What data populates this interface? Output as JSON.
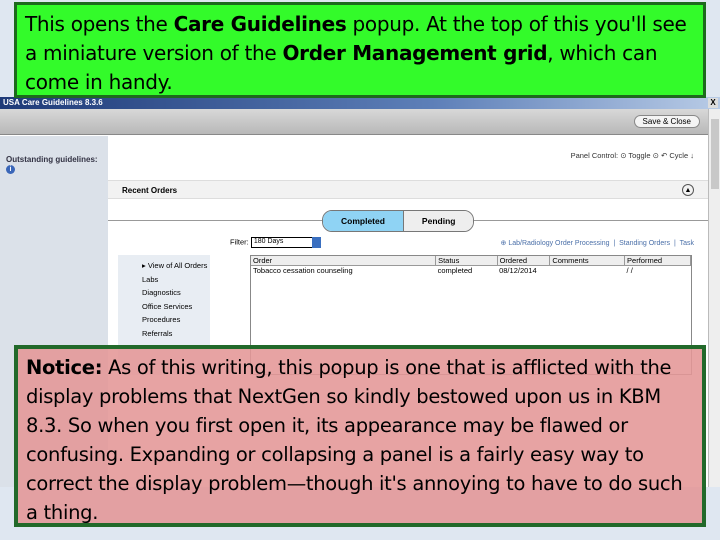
{
  "top_callout": {
    "p1": "This opens the ",
    "b1": "Care Guidelines",
    "p2": " popup.  At the top of this you'll see a miniature version of the ",
    "b2": "Order Management grid",
    "p3": ", which can come in handy."
  },
  "notice": {
    "label": "Notice:",
    "text": " As of this writing, this popup is one that is afflicted with the display problems that NextGen so kindly bestowed upon us in KBM 8.3.  So when you first open it, its appearance may be flawed or confusing.  Expanding or collapsing a panel is a fairly easy way to correct the display problem—though it's annoying to have to do such a thing."
  },
  "window": {
    "title": "USA Care Guidelines 8.3.6",
    "close": "X",
    "save_close": "Save & Close"
  },
  "left": {
    "outstanding": "Outstanding guidelines:"
  },
  "panel_control": {
    "label": "Panel Control:",
    "toggle": "Toggle",
    "cycle": "Cycle"
  },
  "recent_orders": {
    "title": "Recent Orders",
    "tabs": [
      "Completed",
      "Pending"
    ],
    "active_tab": "Completed",
    "filter_label": "Filter:",
    "filter_value": "180 Days",
    "links": [
      "Lab/Radiology Order Processing",
      "Standing Orders",
      "Task"
    ],
    "nav": [
      "View of All Orders",
      "Labs",
      "Diagnostics",
      "Office Services",
      "Procedures",
      "Referrals"
    ],
    "columns": [
      "Order",
      "Status",
      "Ordered",
      "Comments",
      "Performed"
    ],
    "rows": [
      [
        "Tobacco cessation counseling",
        "completed",
        "08/12/2014",
        "",
        "/ /"
      ]
    ]
  },
  "colors": {
    "callout_green": "#33fb2a",
    "notice_pink": "#e49696",
    "border_green": "#22692a"
  }
}
